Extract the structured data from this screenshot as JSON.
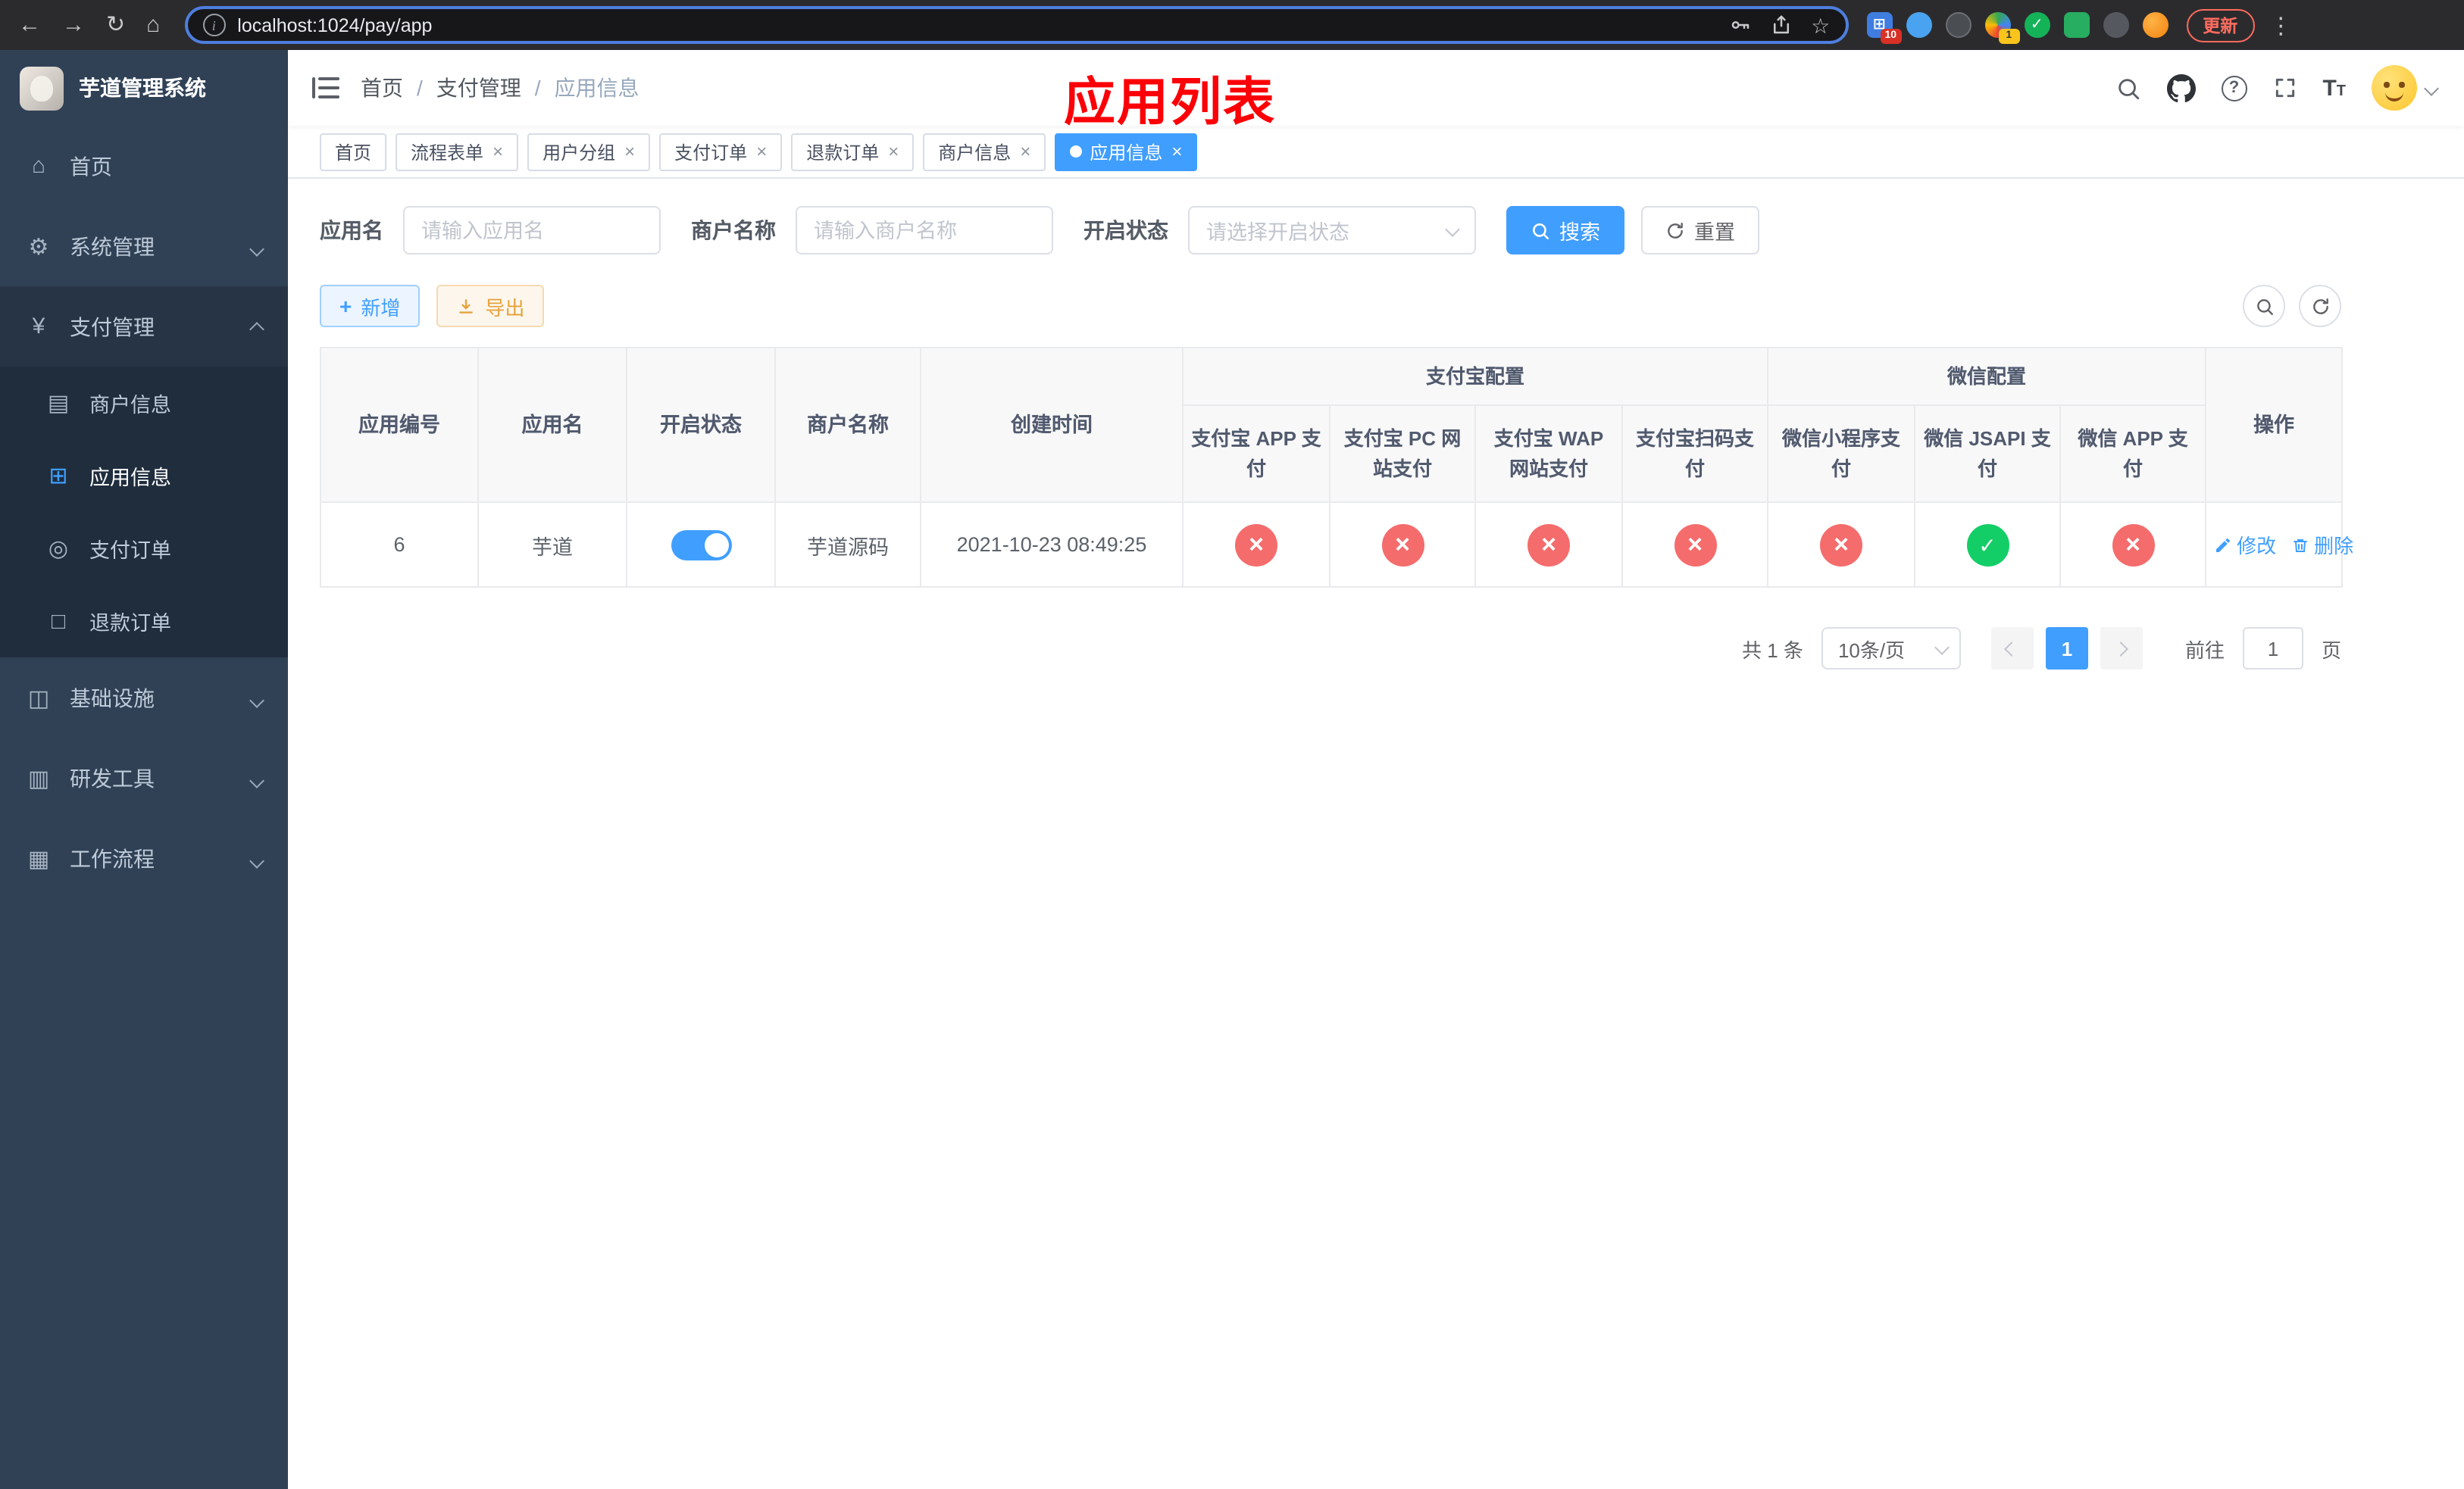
{
  "browser": {
    "url": "localhost:1024/pay/app",
    "update_label": "更新",
    "ext_badge_1": "10",
    "ext_badge_2": "1"
  },
  "overlay_title": "应用列表",
  "sidebar": {
    "title": "芋道管理系统",
    "home": "首页",
    "system": "系统管理",
    "payment": "支付管理",
    "merchant_info": "商户信息",
    "app_info": "应用信息",
    "pay_order": "支付订单",
    "refund_order": "退款订单",
    "infrastructure": "基础设施",
    "dev_tools": "研发工具",
    "workflow": "工作流程"
  },
  "breadcrumb": {
    "home": "首页",
    "section": "支付管理",
    "current": "应用信息"
  },
  "tabs": [
    {
      "label": "首页"
    },
    {
      "label": "流程表单"
    },
    {
      "label": "用户分组"
    },
    {
      "label": "支付订单"
    },
    {
      "label": "退款订单"
    },
    {
      "label": "商户信息"
    },
    {
      "label": "应用信息"
    }
  ],
  "filters": {
    "app_name_label": "应用名",
    "app_name_placeholder": "请输入应用名",
    "merchant_label": "商户名称",
    "merchant_placeholder": "请输入商户名称",
    "status_label": "开启状态",
    "status_placeholder": "请选择开启状态",
    "search_label": "搜索",
    "reset_label": "重置"
  },
  "toolbar": {
    "add_label": "新增",
    "export_label": "导出"
  },
  "table": {
    "groups": {
      "alipay": "支付宝配置",
      "wechat": "微信配置"
    },
    "columns": {
      "id": "应用编号",
      "name": "应用名",
      "status": "开启状态",
      "merchant": "商户名称",
      "created": "创建时间",
      "alipay_app": "支付宝 APP 支付",
      "alipay_pc": "支付宝 PC 网站支付",
      "alipay_wap": "支付宝 WAP 网站支付",
      "alipay_qr": "支付宝扫码支付",
      "wx_mini": "微信小程序支付",
      "wx_jsapi": "微信 JSAPI 支付",
      "wx_app": "微信 APP 支付",
      "actions": "操作"
    },
    "row": {
      "id": "6",
      "name": "芋道",
      "enabled": true,
      "merchant": "芋道源码",
      "created": "2021-10-23 08:49:25",
      "alipay_app": false,
      "alipay_pc": false,
      "alipay_wap": false,
      "alipay_qr": false,
      "wx_mini": false,
      "wx_jsapi": true,
      "wx_app": false,
      "edit_label": "修改",
      "delete_label": "删除"
    }
  },
  "pagination": {
    "total": "共 1 条",
    "page_size": "10条/页",
    "page": "1",
    "goto_label": "前往",
    "goto_value": "1",
    "unit_label": "页"
  }
}
